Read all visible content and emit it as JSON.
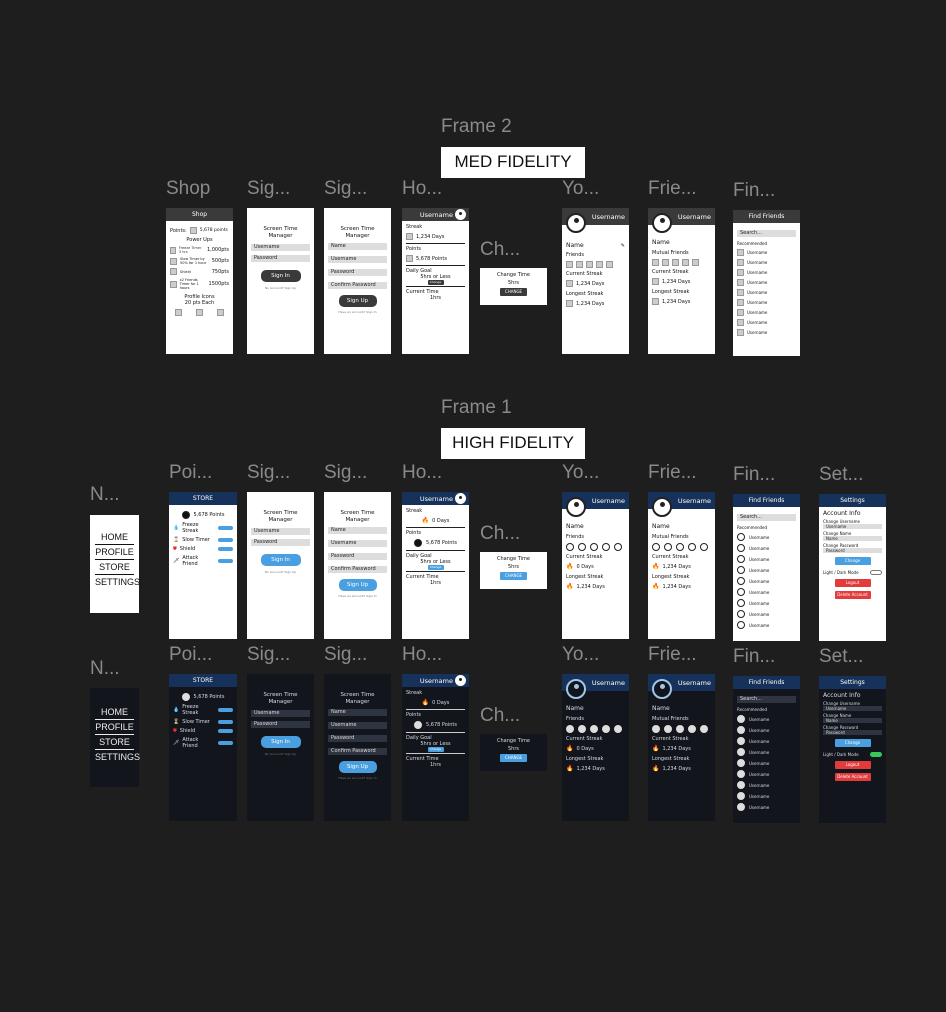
{
  "sections": {
    "frame2_title": "Frame 2",
    "frame2_sub": "MED FIDELITY",
    "frame1_title": "Frame 1",
    "frame1_sub": "HIGH FIDELITY"
  },
  "labels": {
    "shop": "Shop",
    "sig": "Sig...",
    "ho": "Ho...",
    "ch": "Ch...",
    "yo": "Yo...",
    "frie": "Frie...",
    "fin": "Fin...",
    "poi": "Poi...",
    "set": "Set...",
    "n": "N..."
  },
  "nav": [
    "HOME",
    "PROFILE",
    "STORE",
    "SETTINGS"
  ],
  "shop": {
    "header": "Shop",
    "points_label": "Points:",
    "points": "5,678 points",
    "powerups": "Power Ups",
    "items": [
      {
        "name": "Freeze Timer 3 hrs",
        "price": "1,000pts"
      },
      {
        "name": "Slow Timer by 50% for 1 hour",
        "price": "500pts"
      },
      {
        "name": "Shield",
        "price": "750pts"
      },
      {
        "name": "x2 Friends Timer for 1 hours",
        "price": "1500pts"
      }
    ],
    "profile_icons": "Profile Icons",
    "profile_price": "20 pts Each"
  },
  "store": {
    "header": "STORE",
    "points": "5,678 Points",
    "items": [
      "Freeze Streak",
      "Slow Timer",
      "Shield",
      "Attack Friend"
    ]
  },
  "signin": {
    "app": "Screen Time Manager",
    "username": "Username",
    "password": "Password",
    "button": "Sign In",
    "footer": "No Account? Sign Up"
  },
  "signup": {
    "app": "Screen Time Manager",
    "name": "Name",
    "username": "Username",
    "password": "Password",
    "confirm": "Confirm Password",
    "button": "Sign Up",
    "footer": "Have an account? Sign In"
  },
  "home": {
    "user": "Username",
    "streak": "Streak",
    "streak_med": "1,234 Days",
    "streak_hi": "0 Days",
    "points": "Points",
    "points_val": "5,678 Points",
    "goal": "Daily Goal",
    "goal_val": "5hrs or Less",
    "goal_btn": "Change",
    "time": "Current Time",
    "time_val": "1hrs"
  },
  "change": {
    "title": "Change Time",
    "val": "5hrs",
    "button": "CHANGE"
  },
  "you": {
    "user": "Username",
    "name": "Name",
    "friends": "Friends",
    "current": "Current Streak",
    "current_med": "1,234 Days",
    "current_hi": "0 Days",
    "longest": "Longest Streak",
    "longest_val": "1,234 Days"
  },
  "friend": {
    "user": "Username",
    "name": "Name",
    "mutual": "Mutual Friends",
    "current": "Current Streak",
    "current_val": "1,234 Days",
    "longest": "Longest Streak",
    "longest_val": "1,234 Days"
  },
  "find": {
    "header": "Find Friends",
    "search": "Search...",
    "recommended": "Recommended",
    "user": "Username"
  },
  "settings": {
    "header": "Settings",
    "account": "Account Info",
    "change_username": "Change Username",
    "username": "Username",
    "change_name": "Change Name",
    "name": "Name",
    "change_password": "Change Password",
    "password": "Password",
    "change_btn": "Change",
    "mode": "Light / Dark Mode",
    "logout": "Logout",
    "delete": "Delete Account"
  }
}
